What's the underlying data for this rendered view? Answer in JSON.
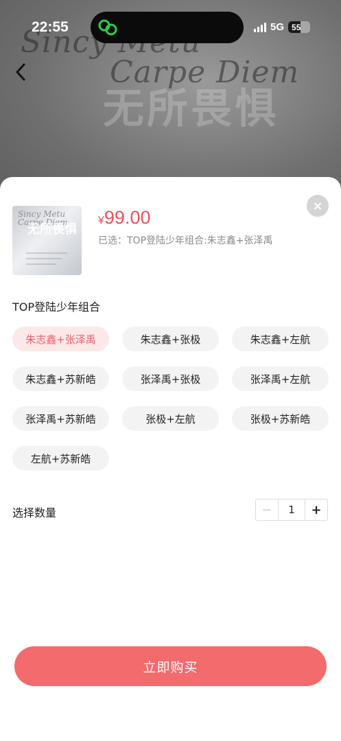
{
  "status_bar": {
    "time": "22:55",
    "network": "5G",
    "battery": "55",
    "battery_level": 0.55
  },
  "hero": {
    "script_line1": "Sincy Metu",
    "script_line2": "Carpe Diem",
    "title_cjk": "无所畏惧"
  },
  "product": {
    "currency": "¥",
    "price": "99.00",
    "selected_text": "已选：TOP登陆少年组合:朱志鑫+张泽禹",
    "thumb_script": "Sincy Metu Carpe Diem",
    "thumb_cjk": "无所畏惧"
  },
  "group": {
    "title": "TOP登陆少年组合",
    "options": [
      {
        "label": "朱志鑫+张泽禹",
        "active": true
      },
      {
        "label": "朱志鑫+张极",
        "active": false
      },
      {
        "label": "朱志鑫+左航",
        "active": false
      },
      {
        "label": "朱志鑫+苏新皓",
        "active": false
      },
      {
        "label": "张泽禹+张极",
        "active": false
      },
      {
        "label": "张泽禹+左航",
        "active": false
      },
      {
        "label": "张泽禹+苏新皓",
        "active": false
      },
      {
        "label": "张极+左航",
        "active": false
      },
      {
        "label": "张极+苏新皓",
        "active": false
      },
      {
        "label": "左航+苏新皓",
        "active": false
      }
    ]
  },
  "quantity": {
    "label": "选择数量",
    "value": "1",
    "minus": "−",
    "plus": "+"
  },
  "buy_button": {
    "label": "立即购买"
  },
  "close_symbol": "×",
  "colors": {
    "accent": "#f46b6e",
    "price": "#f0505a",
    "active_chip_bg": "#fde8e8",
    "chip_bg": "#f3f3f3"
  }
}
